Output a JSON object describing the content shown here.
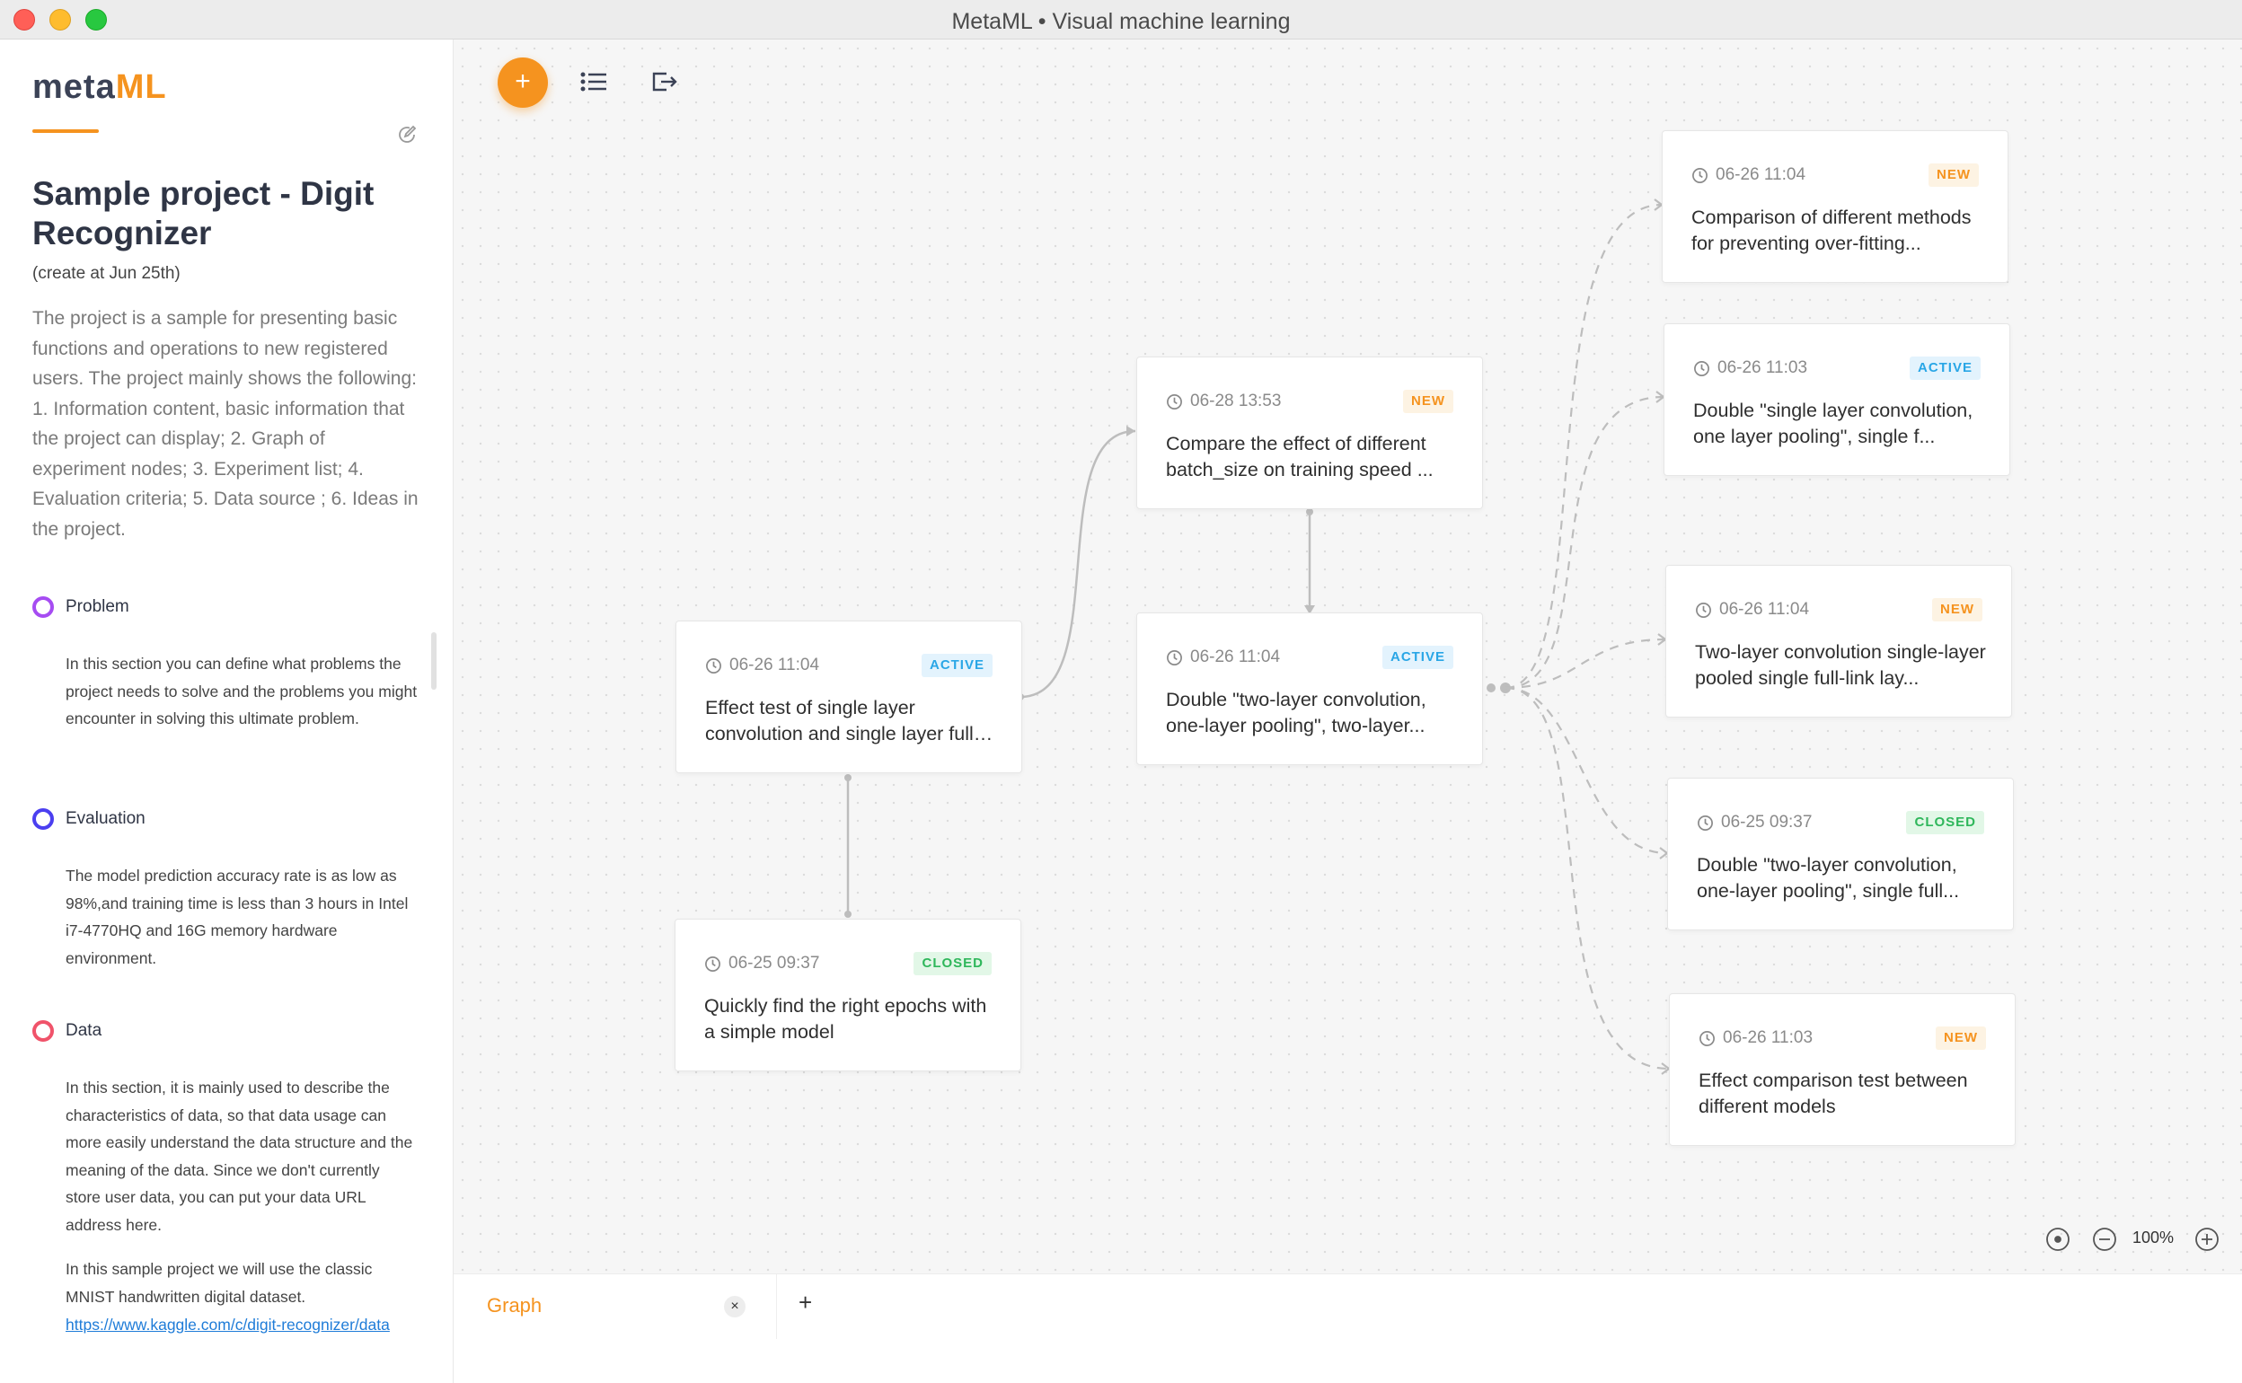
{
  "window": {
    "title": "MetaML • Visual machine learning"
  },
  "sidebar": {
    "logo": {
      "part1": "meta",
      "part2": "ML"
    },
    "project_title": "Sample project - Digit Recognizer",
    "project_date": "(create at Jun 25th)",
    "description": "The project is a sample for presenting basic functions and operations to new registered users. The project mainly shows the following: 1. Information content, basic information that the project can display; 2. Graph of experiment nodes; 3. Experiment list; 4. Evaluation criteria; 5. Data source ; 6. Ideas in the project.",
    "sections": {
      "problem": {
        "label": "Problem",
        "color": "#a64cf2",
        "text": "In this section you can define what problems the project needs to solve and the problems you might encounter in solving this ultimate problem."
      },
      "evaluation": {
        "label": "Evaluation",
        "color": "#4b3ff0",
        "text": "The model prediction accuracy rate is as low as 98%,and training time is less than 3 hours in Intel i7-4770HQ and 16G memory hardware environment."
      },
      "data": {
        "label": "Data",
        "color": "#f0536a",
        "text": "In this section, it is mainly used to describe the characteristics of data, so that data usage can more easily understand the data structure and the meaning of the data. Since we don't currently store user data, you can put your data URL address here.",
        "text2": "In this sample project we will use the classic MNIST handwritten digital dataset.",
        "link": "https://www.kaggle.com/c/digit-recognizer/data"
      }
    }
  },
  "toolbar": {
    "add_label": "+",
    "list_icon": "list-icon",
    "export_icon": "export-icon"
  },
  "nodes": {
    "n1": {
      "time": "06-26 11:04",
      "status": "ACTIVE",
      "desc": "Effect test of single layer convolution and single layer full link..."
    },
    "n2": {
      "time": "06-25 09:37",
      "status": "CLOSED",
      "desc": "Quickly find the right epochs with a simple model"
    },
    "n3": {
      "time": "06-28 13:53",
      "status": "NEW",
      "desc": "Compare the effect of different batch_size on training speed ..."
    },
    "n4": {
      "time": "06-26 11:04",
      "status": "ACTIVE",
      "desc": "Double \"two-layer convolution, one-layer pooling\", two-layer..."
    },
    "n5": {
      "time": "06-26 11:04",
      "status": "NEW",
      "desc": "Comparison of different methods for preventing over-fitting..."
    },
    "n6": {
      "time": "06-26 11:03",
      "status": "ACTIVE",
      "desc": "Double \"single layer convolution, one layer pooling\", single f..."
    },
    "n7": {
      "time": "06-26 11:04",
      "status": "NEW",
      "desc": "Two-layer convolution single-layer pooled single full-link lay..."
    },
    "n8": {
      "time": "06-25 09:37",
      "status": "CLOSED",
      "desc": "Double \"two-layer convolution, one-layer pooling\", single full..."
    },
    "n9": {
      "time": "06-26 11:03",
      "status": "NEW",
      "desc": "Effect comparison test between different models"
    }
  },
  "zoom": {
    "level": "100%"
  },
  "tabs": {
    "graph": "Graph",
    "close": "×",
    "add": "+"
  },
  "colors": {
    "accent": "#f5931f",
    "new": "#f5931f",
    "active": "#29a6e6",
    "closed": "#2fb75b"
  }
}
